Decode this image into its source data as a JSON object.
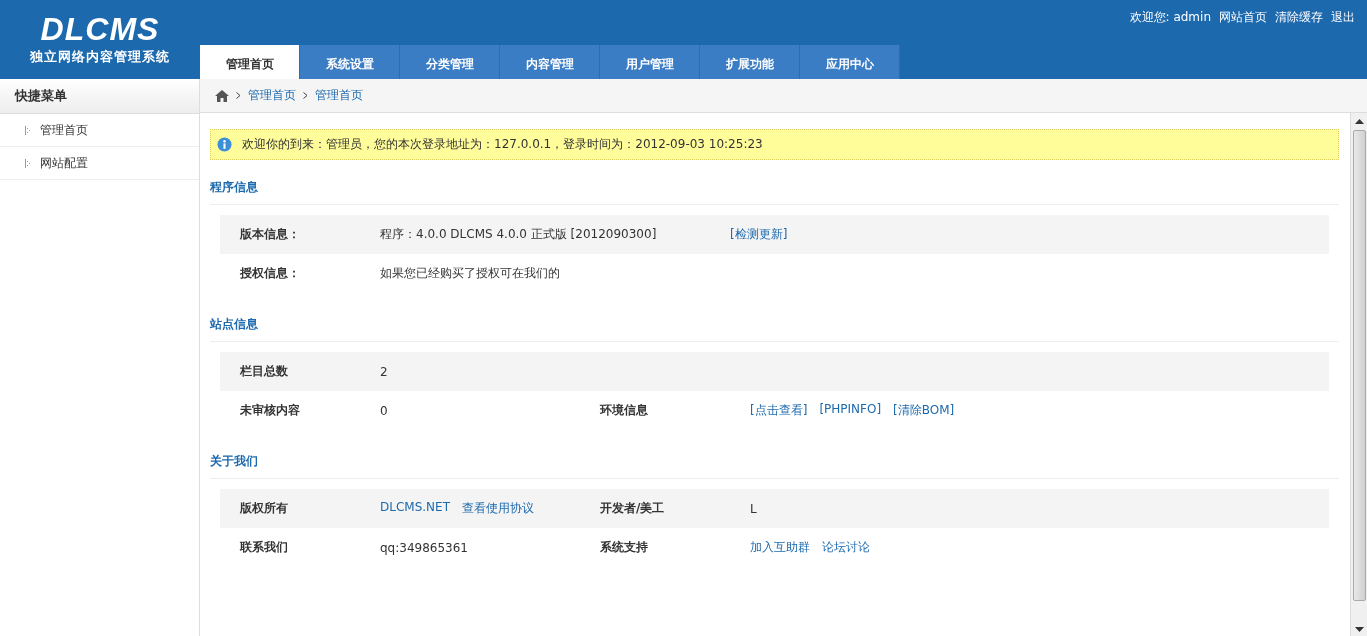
{
  "logo": {
    "title": "DLCMS",
    "subtitle": "独立网络内容管理系统"
  },
  "welcome": "欢迎您: admin",
  "top_links": [
    "网站首页",
    "清除缓存",
    "退出"
  ],
  "tabs": [
    {
      "label": "管理首页",
      "selected": true
    },
    {
      "label": "系统设置",
      "selected": false
    },
    {
      "label": "分类管理",
      "selected": false
    },
    {
      "label": "内容管理",
      "selected": false
    },
    {
      "label": "用户管理",
      "selected": false
    },
    {
      "label": "扩展功能",
      "selected": false
    },
    {
      "label": "应用中心",
      "selected": false
    }
  ],
  "sidebar": {
    "title": "快捷菜单",
    "items": [
      {
        "label": "管理首页"
      },
      {
        "label": "网站配置"
      }
    ]
  },
  "breadcrumb": [
    "管理首页",
    "管理首页"
  ],
  "notice": "欢迎你的到来：管理员，您的本次登录地址为：127.0.0.1，登录时间为：2012-09-03 10:25:23",
  "sections": [
    {
      "title": "程序信息",
      "kind": "wide",
      "rows": [
        [
          {
            "kind": "label",
            "text": "版本信息："
          },
          {
            "kind": "text",
            "text": "程序：4.0.0 DLCMS 4.0.0 正式版 [2012090300]"
          },
          {
            "kind": "links",
            "links": [
              "[检测更新]"
            ]
          }
        ],
        [
          {
            "kind": "label",
            "text": "授权信息："
          },
          {
            "kind": "text",
            "text": "如果您已经购买了授权可在我们的"
          }
        ]
      ]
    },
    {
      "title": "站点信息",
      "kind": "grid",
      "rows": [
        [
          {
            "kind": "label",
            "text": "栏目总数"
          },
          {
            "kind": "text",
            "text": "2"
          }
        ],
        [
          {
            "kind": "label",
            "text": "未审核内容"
          },
          {
            "kind": "text",
            "text": "0"
          },
          {
            "kind": "label",
            "text": "环境信息"
          },
          {
            "kind": "links",
            "links": [
              "[点击查看]",
              "[PHPINFO]",
              "[清除BOM]"
            ]
          }
        ]
      ]
    },
    {
      "title": "关于我们",
      "kind": "grid",
      "rows": [
        [
          {
            "kind": "label",
            "text": "版权所有"
          },
          {
            "kind": "links",
            "links": [
              "DLCMS.NET",
              "查看使用协议"
            ]
          },
          {
            "kind": "label",
            "text": "开发者/美工"
          },
          {
            "kind": "text",
            "text": "L"
          }
        ],
        [
          {
            "kind": "label",
            "text": "联系我们"
          },
          {
            "kind": "text",
            "text": "qq:349865361"
          },
          {
            "kind": "label",
            "text": "系统支持"
          },
          {
            "kind": "links",
            "links": [
              "加入互助群",
              "论坛讨论"
            ]
          }
        ]
      ]
    }
  ]
}
